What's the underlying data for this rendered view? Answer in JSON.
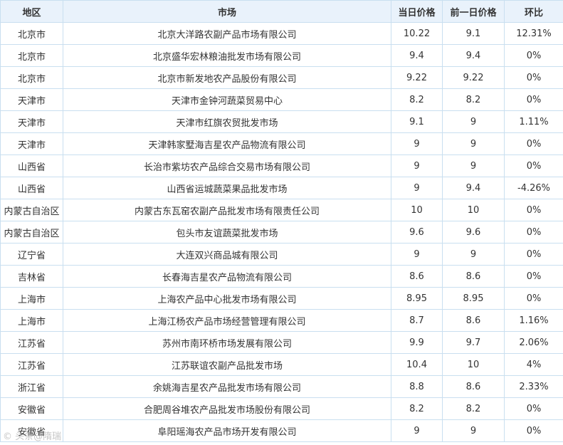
{
  "table": {
    "headers": {
      "region": "地区",
      "market": "市场",
      "today_price": "当日价格",
      "prev_price": "前一日价格",
      "ratio": "环比"
    },
    "rows": [
      {
        "region": "北京市",
        "market": "北京大洋路农副产品市场有限公司",
        "today": "10.22",
        "prev": "9.1",
        "ratio": "12.31%"
      },
      {
        "region": "北京市",
        "market": "北京盛华宏林粮油批发市场有限公司",
        "today": "9.4",
        "prev": "9.4",
        "ratio": "0%"
      },
      {
        "region": "北京市",
        "market": "北京市新发地农产品股份有限公司",
        "today": "9.22",
        "prev": "9.22",
        "ratio": "0%"
      },
      {
        "region": "天津市",
        "market": "天津市金钟河蔬菜贸易中心",
        "today": "8.2",
        "prev": "8.2",
        "ratio": "0%"
      },
      {
        "region": "天津市",
        "market": "天津市红旗农贸批发市场",
        "today": "9.1",
        "prev": "9",
        "ratio": "1.11%"
      },
      {
        "region": "天津市",
        "market": "天津韩家墅海吉星农产品物流有限公司",
        "today": "9",
        "prev": "9",
        "ratio": "0%"
      },
      {
        "region": "山西省",
        "market": "长治市紫坊农产品综合交易市场有限公司",
        "today": "9",
        "prev": "9",
        "ratio": "0%"
      },
      {
        "region": "山西省",
        "market": "山西省运城蔬菜果品批发市场",
        "today": "9",
        "prev": "9.4",
        "ratio": "-4.26%"
      },
      {
        "region": "内蒙古自治区",
        "market": "内蒙古东瓦窑农副产品批发市场有限责任公司",
        "today": "10",
        "prev": "10",
        "ratio": "0%"
      },
      {
        "region": "内蒙古自治区",
        "market": "包头市友谊蔬菜批发市场",
        "today": "9.6",
        "prev": "9.6",
        "ratio": "0%"
      },
      {
        "region": "辽宁省",
        "market": "大连双兴商品城有限公司",
        "today": "9",
        "prev": "9",
        "ratio": "0%"
      },
      {
        "region": "吉林省",
        "market": "长春海吉星农产品物流有限公司",
        "today": "8.6",
        "prev": "8.6",
        "ratio": "0%"
      },
      {
        "region": "上海市",
        "market": "上海农产品中心批发市场有限公司",
        "today": "8.95",
        "prev": "8.95",
        "ratio": "0%"
      },
      {
        "region": "上海市",
        "market": "上海江杨农产品市场经营管理有限公司",
        "today": "8.7",
        "prev": "8.6",
        "ratio": "1.16%"
      },
      {
        "region": "江苏省",
        "market": "苏州市南环桥市场发展有限公司",
        "today": "9.9",
        "prev": "9.7",
        "ratio": "2.06%"
      },
      {
        "region": "江苏省",
        "market": "江苏联谊农副产品批发市场",
        "today": "10.4",
        "prev": "10",
        "ratio": "4%"
      },
      {
        "region": "浙江省",
        "market": "余姚海吉星农产品批发市场有限公司",
        "today": "8.8",
        "prev": "8.6",
        "ratio": "2.33%"
      },
      {
        "region": "安徽省",
        "market": "合肥周谷堆农产品批发市场股份有限公司",
        "today": "8.2",
        "prev": "8.2",
        "ratio": "0%"
      },
      {
        "region": "安徽省",
        "market": "阜阳瑶海农产品市场开发有限公司",
        "today": "9",
        "prev": "9",
        "ratio": "0%"
      }
    ]
  },
  "watermark": "© 头条@隋瑞"
}
